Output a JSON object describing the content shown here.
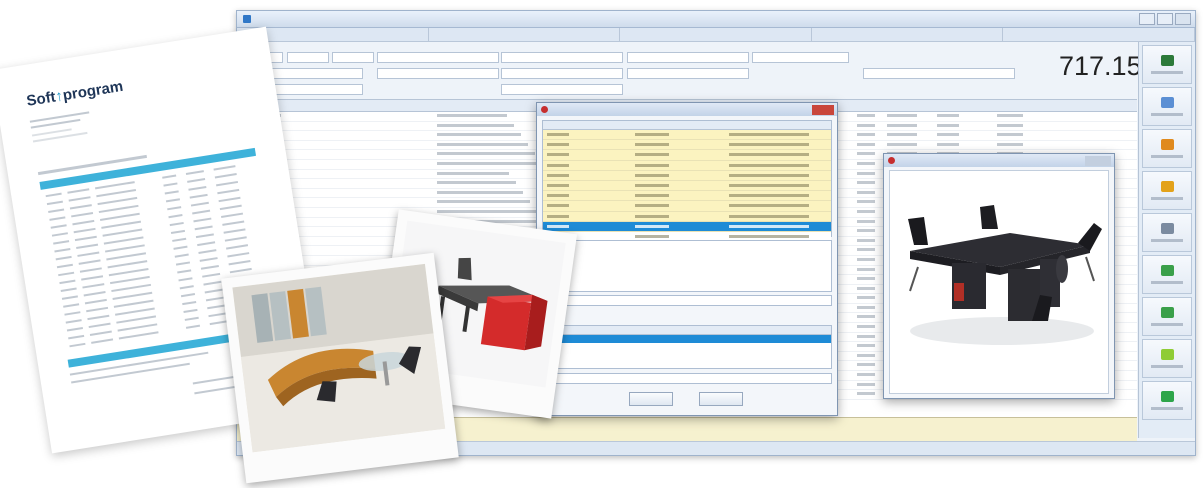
{
  "app": {
    "document_total": "717.15",
    "toolbar_button_count": 9
  },
  "brand": {
    "logo_prefix": "Soft",
    "logo_suffix": "program"
  },
  "colors": {
    "accent_blue": "#1e8bd6",
    "highlight_yellow": "#fbf3c0",
    "doc_header_blue": "#3eb2da",
    "close_red": "#c9463b",
    "desk_red": "#d42b2b",
    "desk_orange": "#c98630"
  },
  "search_dialog": {
    "row_count": 12,
    "selected_row_index": 9
  },
  "icons": [
    "app-icon",
    "close-icon",
    "printer-icon",
    "box-icon",
    "tag-icon",
    "lightning-icon",
    "send-icon",
    "save-icon"
  ]
}
